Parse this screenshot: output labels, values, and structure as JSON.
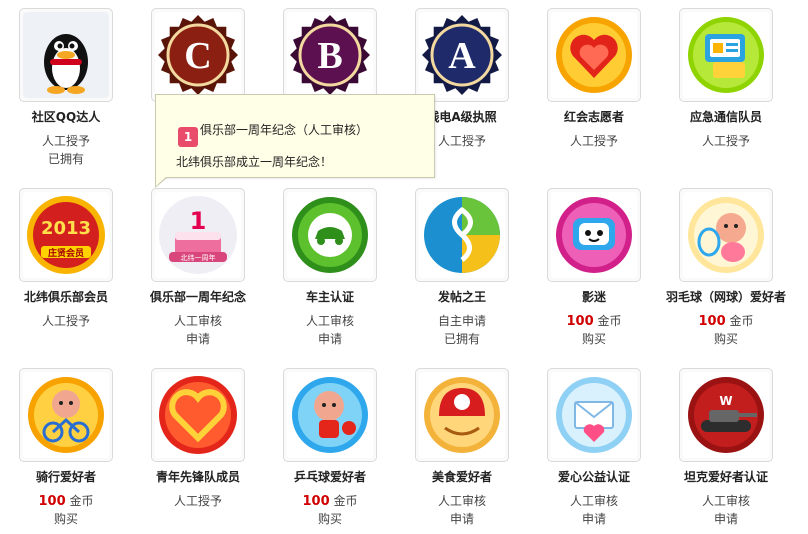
{
  "badges": [
    {
      "id": "qq",
      "icon": "qq-penguin-icon",
      "name": "社区QQ达人",
      "line1": "人工授予",
      "line2": "已拥有"
    },
    {
      "id": "c",
      "icon": "c-medal-icon",
      "name": "",
      "line1": "",
      "line2": ""
    },
    {
      "id": "b",
      "icon": "b-medal-icon",
      "name": "",
      "line1": "",
      "line2": ""
    },
    {
      "id": "a",
      "icon": "a-medal-icon",
      "name": "线电A级执照",
      "line1": "人工授予",
      "line2": ""
    },
    {
      "id": "redcross",
      "icon": "red-heart-scarf-icon",
      "name": "红会志愿者",
      "line1": "人工授予",
      "line2": ""
    },
    {
      "id": "emergency",
      "icon": "chat-bubble-icon",
      "name": "应急通信队员",
      "line1": "人工授予",
      "line2": ""
    },
    {
      "id": "member2013",
      "icon": "member-2013-icon",
      "name": "北纬俱乐部会员",
      "line1": "人工授予",
      "line2": ""
    },
    {
      "id": "anniv",
      "icon": "anniversary-cake-icon",
      "name": "俱乐部一周年纪念",
      "line1": "人工审核",
      "line2": "申请"
    },
    {
      "id": "car",
      "icon": "car-icon",
      "name": "车主认证",
      "line1": "人工审核",
      "line2": "申请"
    },
    {
      "id": "poster",
      "icon": "spiral-icon",
      "name": "发帖之王",
      "line1": "自主申请",
      "line2": "已拥有"
    },
    {
      "id": "movie",
      "icon": "tv-mascot-icon",
      "name": "影迷",
      "price": "100",
      "unit": "金币",
      "line2": "购买"
    },
    {
      "id": "badminton",
      "icon": "tennis-mascot-icon",
      "name": "羽毛球（网球）爱好者",
      "price": "100",
      "unit": "金币",
      "line2": "购买"
    },
    {
      "id": "cycling",
      "icon": "cycling-mascot-icon",
      "name": "骑行爱好者",
      "price": "100",
      "unit": "金币",
      "line2": "购买"
    },
    {
      "id": "youth",
      "icon": "youth-heart-icon",
      "name": "青年先锋队成员",
      "line1": "人工授予",
      "line2": ""
    },
    {
      "id": "pingpong",
      "icon": "pingpong-mascot-icon",
      "name": "乒乓球爱好者",
      "price": "100",
      "unit": "金币",
      "line2": "购买"
    },
    {
      "id": "food",
      "icon": "chef-hat-icon",
      "name": "美食爱好者",
      "line1": "人工审核",
      "line2": "申请"
    },
    {
      "id": "charity",
      "icon": "love-letter-icon",
      "name": "爱心公益认证",
      "line1": "人工审核",
      "line2": "申请"
    },
    {
      "id": "tank",
      "icon": "tank-icon",
      "name": "坦克爱好者认证",
      "line1": "人工审核",
      "line2": "申请"
    }
  ],
  "tooltip": {
    "icon": "cake-small-icon",
    "icon_glyph": "1",
    "title": "俱乐部一周年纪念（人工审核）",
    "desc": "北纬俱乐部成立一周年纪念！"
  },
  "medal_letters": {
    "c": "C",
    "b": "B",
    "a": "A"
  },
  "badge_text": {
    "member2013": "2013",
    "member_sub": "庄贤会员",
    "anniv_one": "1",
    "anniv_sub": "北纬一周年"
  },
  "colors": {
    "price": "#d00000",
    "c": "#8a1f12",
    "b": "#5c1050",
    "a": "#1e2a6a"
  }
}
